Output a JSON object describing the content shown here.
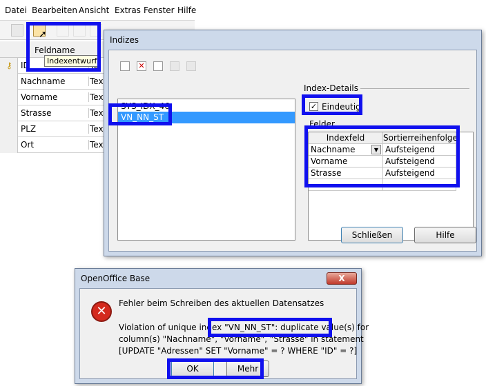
{
  "menu": [
    "Datei",
    "Bearbeiten",
    "Ansicht",
    "Extras",
    "Fenster",
    "Hilfe"
  ],
  "tooltip": "Indexentwurf",
  "table": {
    "header": "Feldname",
    "rows": [
      {
        "name": "ID",
        "type": "Te"
      },
      {
        "name": "Nachname",
        "type": "Text"
      },
      {
        "name": "Vorname",
        "type": "Text"
      },
      {
        "name": "Strasse",
        "type": "Text"
      },
      {
        "name": "PLZ",
        "type": "Text"
      },
      {
        "name": "Ort",
        "type": "Text"
      }
    ]
  },
  "indizes": {
    "title": "Indizes",
    "index_list": [
      "SYS_IDX_46",
      "VN_NN_ST"
    ],
    "details_label": "Index-Details",
    "unique_label": "Eindeutig",
    "fields_label": "Felder",
    "col_field": "Indexfeld",
    "col_sort": "Sortierreihenfolge",
    "fields": [
      {
        "field": "Nachname",
        "sort": "Aufsteigend"
      },
      {
        "field": "Vorname",
        "sort": "Aufsteigend"
      },
      {
        "field": "Strasse",
        "sort": "Aufsteigend"
      }
    ],
    "close_button": "Schließen",
    "help_button": "Hilfe"
  },
  "error": {
    "title": "OpenOffice Base",
    "heading": "Fehler beim Schreiben des aktuellen Datensatzes",
    "line1_a": "Violation of unique index ",
    "line1_b": "\"VN_NN_ST\": duplicate value(s)",
    "line1_c": " for",
    "line2": "column(s) \"Nachname\", \"Vorname\", \"Strasse\" in statement",
    "line3": "[UPDATE \"Adressen\" SET \"Vorname\" = ? WHERE \"ID\" = ?]",
    "ok_button": "OK",
    "more_button": "Mehr",
    "close_glyph": "X"
  }
}
